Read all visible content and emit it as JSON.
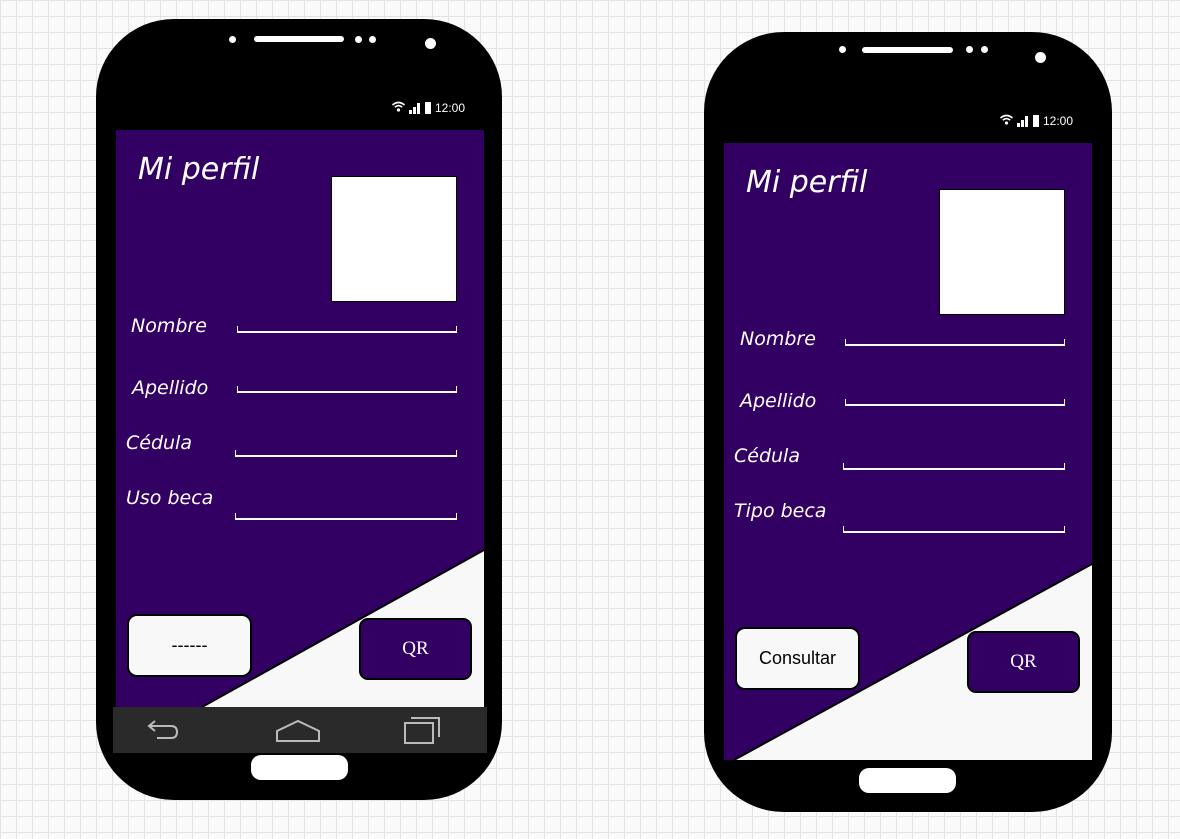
{
  "phones": [
    {
      "status_time": "12:00",
      "title": "Mi perfil",
      "fields": [
        {
          "label": "Nombre"
        },
        {
          "label": "Apellido"
        },
        {
          "label": "Cédula"
        },
        {
          "label": "Uso beca"
        }
      ],
      "left_button": "------",
      "right_button": "QR",
      "has_navbar": true
    },
    {
      "status_time": "12:00",
      "title": "Mi perfil",
      "fields": [
        {
          "label": "Nombre"
        },
        {
          "label": "Apellido"
        },
        {
          "label": "Cédula"
        },
        {
          "label": "Tipo beca"
        }
      ],
      "left_button": "Consultar",
      "right_button": "QR",
      "has_navbar": false
    }
  ],
  "colors": {
    "screen_bg": "#320062",
    "panel_light": "#f8f8f8",
    "phone_body": "#000000",
    "navbar": "#2a2a2a"
  },
  "icons": [
    "wifi-icon",
    "signal-icon",
    "battery-icon",
    "back-icon",
    "home-icon",
    "recent-apps-icon"
  ]
}
